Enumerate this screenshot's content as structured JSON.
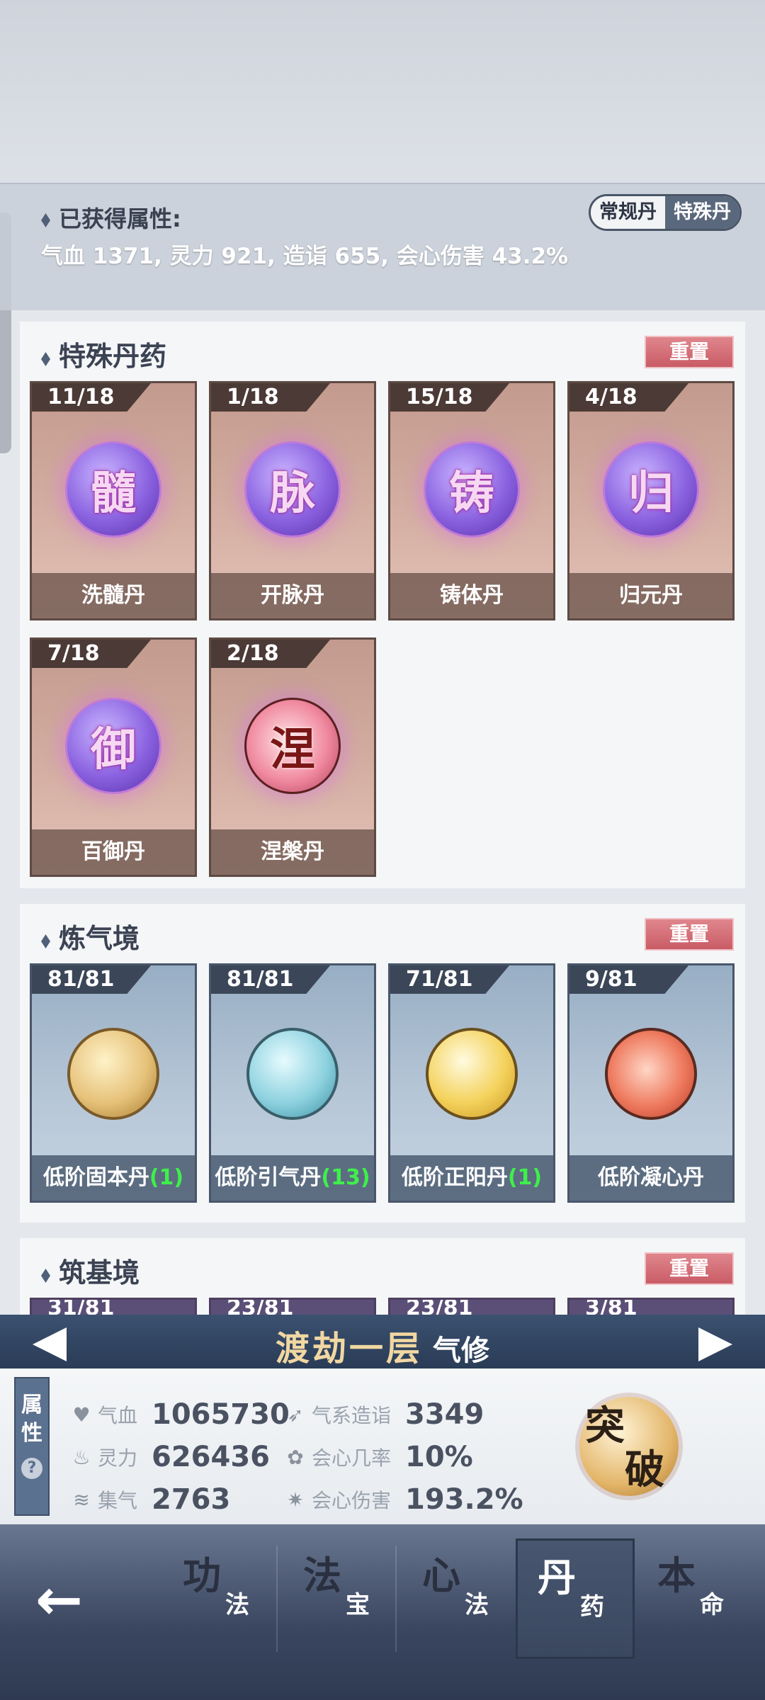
{
  "attributes": {
    "title": "已获得属性:",
    "values": "气血 1371, 灵力 921, 造诣 655, 会心伤害 43.2%",
    "toggle": [
      "常规丹",
      "特殊丹"
    ]
  },
  "sections": {
    "special": {
      "title": "特殊丹药",
      "reset": "重置",
      "items": [
        {
          "count": "11/18",
          "glyph": "髓",
          "name": "洗髓丹"
        },
        {
          "count": "1/18",
          "glyph": "脉",
          "name": "开脉丹"
        },
        {
          "count": "15/18",
          "glyph": "铸",
          "name": "铸体丹"
        },
        {
          "count": "4/18",
          "glyph": "归",
          "name": "归元丹"
        },
        {
          "count": "7/18",
          "glyph": "御",
          "name": "百御丹"
        },
        {
          "count": "2/18",
          "glyph": "涅",
          "name": "涅槃丹"
        }
      ]
    },
    "lianqi": {
      "title": "炼气境",
      "reset": "重置",
      "items": [
        {
          "count": "81/81",
          "name": "低阶固本丹",
          "qty": "(1)"
        },
        {
          "count": "81/81",
          "name": "低阶引气丹",
          "qty": "(13)"
        },
        {
          "count": "71/81",
          "name": "低阶正阳丹",
          "qty": "(1)"
        },
        {
          "count": "9/81",
          "name": "低阶凝心丹",
          "qty": ""
        }
      ]
    },
    "zhuji": {
      "title": "筑基境",
      "reset": "重置",
      "counts": [
        "31/81",
        "23/81",
        "23/81",
        "3/81"
      ]
    }
  },
  "realm": {
    "name": "渡劫一层",
    "type": "气修"
  },
  "stats": {
    "tab": [
      "属",
      "性"
    ],
    "help": "?",
    "qixue": {
      "label": "气血",
      "value": "1065730"
    },
    "lingli": {
      "label": "灵力",
      "value": "626436"
    },
    "jiqi": {
      "label": "集气",
      "value": "2763"
    },
    "zaoyi": {
      "label": "气系造诣",
      "value": "3349"
    },
    "huixin_rate": {
      "label": "会心几率",
      "value": "10%"
    },
    "huixin_dmg": {
      "label": "会心伤害",
      "value": "193.2%"
    },
    "breakthrough": [
      "突",
      "破"
    ]
  },
  "nav": [
    {
      "big": "功",
      "small": "法"
    },
    {
      "big": "法",
      "small": "宝"
    },
    {
      "big": "心",
      "small": "法"
    },
    {
      "big": "丹",
      "small": "药"
    },
    {
      "big": "本",
      "small": "命"
    }
  ]
}
